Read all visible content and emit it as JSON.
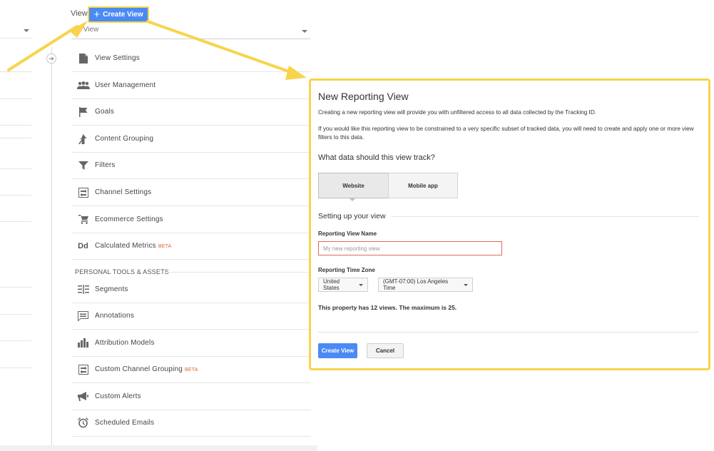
{
  "header": {
    "view_label": "View",
    "create_view_label": "Create View",
    "view_select_value": "ata View"
  },
  "menu": {
    "items": [
      {
        "label": "View Settings",
        "icon": "document-icon"
      },
      {
        "label": "User Management",
        "icon": "people-icon"
      },
      {
        "label": "Goals",
        "icon": "flag-icon"
      },
      {
        "label": "Content Grouping",
        "icon": "grouping-icon"
      },
      {
        "label": "Filters",
        "icon": "filter-icon"
      },
      {
        "label": "Channel Settings",
        "icon": "channel-icon"
      },
      {
        "label": "Ecommerce Settings",
        "icon": "cart-icon"
      },
      {
        "label": "Calculated Metrics",
        "icon": "calculated-metrics-icon",
        "badge": "BETA",
        "glyph": "Dd"
      }
    ],
    "section_title": "PERSONAL TOOLS & ASSETS",
    "personal_items": [
      {
        "label": "Segments",
        "icon": "segments-icon"
      },
      {
        "label": "Annotations",
        "icon": "annotation-icon"
      },
      {
        "label": "Attribution Models",
        "icon": "bar-chart-icon"
      },
      {
        "label": "Custom Channel Grouping",
        "icon": "channel-grouping-icon",
        "badge": "BETA"
      },
      {
        "label": "Custom Alerts",
        "icon": "megaphone-icon"
      },
      {
        "label": "Scheduled Emails",
        "icon": "alarm-clock-icon"
      }
    ]
  },
  "modal": {
    "title": "New Reporting View",
    "intro": "Creating a new reporting view will provide you with unfiltered access to all data collected by the Tracking ID.",
    "filter_note": "If you would like this reporting view to be constrained to a very specific subset of tracked data, you will need to create and apply one or more view filters to this data.",
    "track_question": "What data should this view track?",
    "tabs": [
      "Website",
      "Mobile app"
    ],
    "setup_title": "Setting up your view",
    "name_label": "Reporting View Name",
    "name_placeholder": "My new reporting view",
    "timezone_label": "Reporting Time Zone",
    "country_value": "United States",
    "timezone_value": "(GMT-07:00) Los Angeles Time",
    "limit_text": "This property has 12 views. The maximum is 25.",
    "create_button": "Create View",
    "cancel_button": "Cancel"
  },
  "colors": {
    "accent": "#4a8af4",
    "highlight": "#f7d44c",
    "beta": "#e0661f",
    "error_border": "#e06a5e"
  }
}
